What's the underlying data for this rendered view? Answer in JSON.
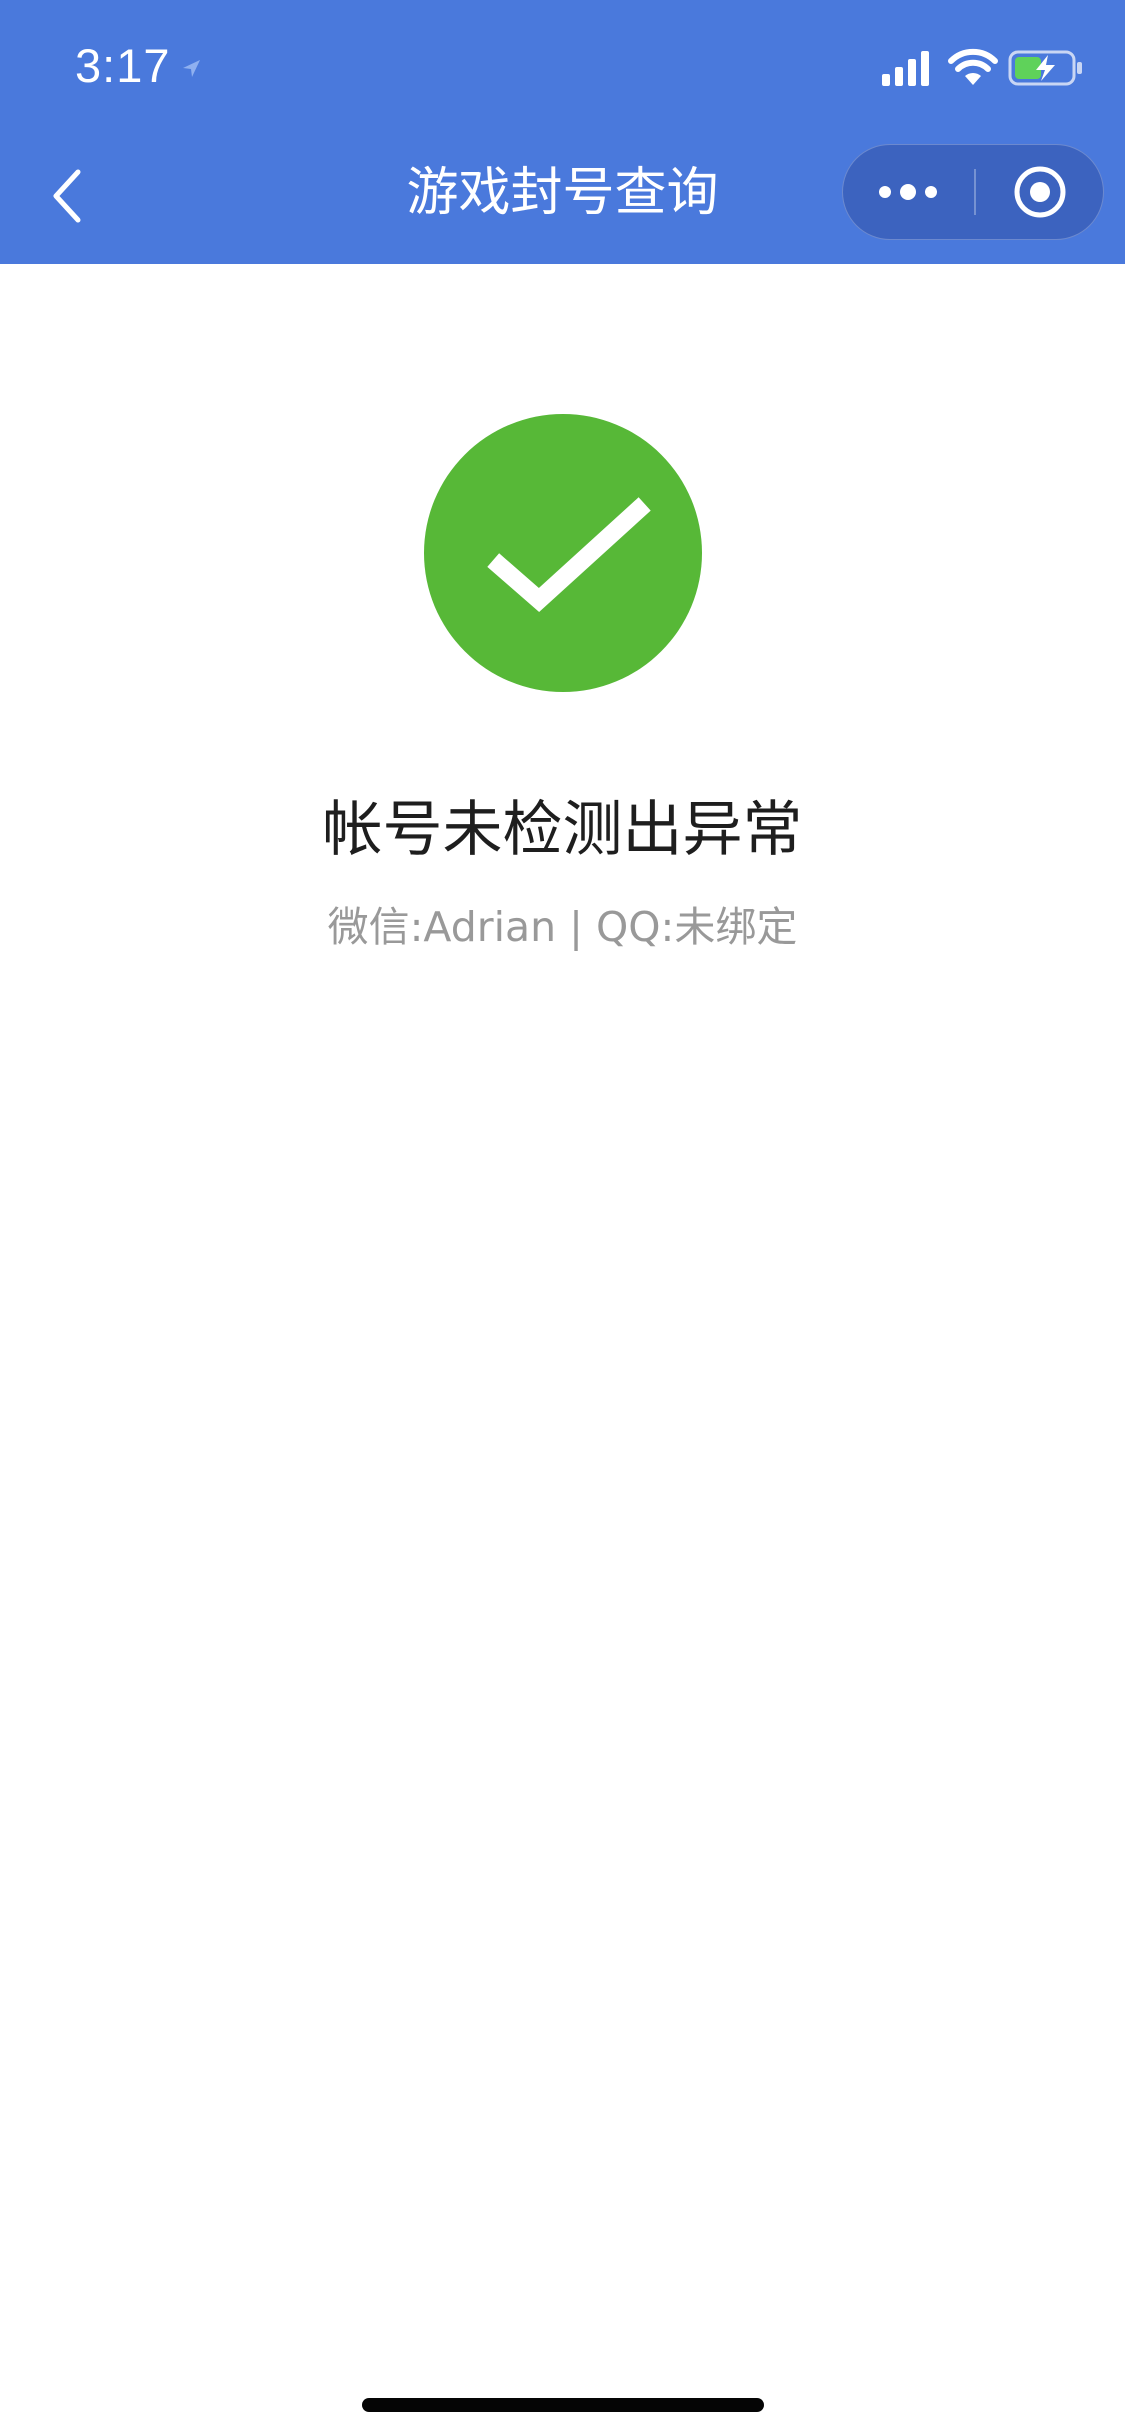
{
  "status_bar": {
    "time": "3:17"
  },
  "nav": {
    "title": "游戏封号查询",
    "back_icon": "chevron-left-icon",
    "more_icon": "more-dots-icon",
    "close_icon": "target-close-icon"
  },
  "result": {
    "status": "success",
    "icon": "check-circle-icon",
    "title": "帐号未检测出异常",
    "subtitle": "微信:Adrian | QQ:未绑定"
  },
  "colors": {
    "nav_background": "#4a79dc",
    "success_green": "#57b837",
    "title_text": "#1e1e1e",
    "subtitle_text": "#999999"
  }
}
